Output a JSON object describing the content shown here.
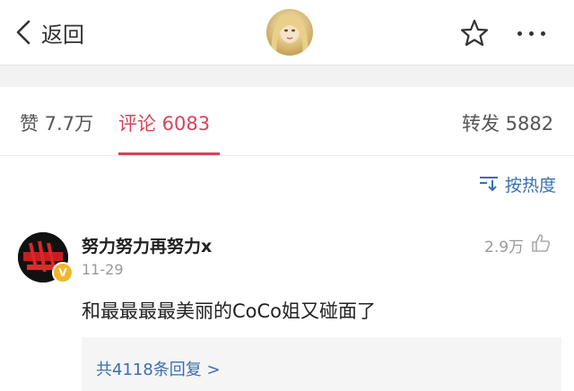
{
  "header": {
    "back_label": "返回",
    "avatar_icon": "profile-avatar",
    "star_icon": "star-icon",
    "more_icon": "more-icon"
  },
  "tabs": {
    "likes": "赞 7.7万",
    "comments": "评论 6083",
    "reposts": "转发 5882"
  },
  "sort": {
    "label": "按热度",
    "icon": "sort-icon"
  },
  "comment": {
    "author": "努力努力再努力x",
    "date": "11-29",
    "likes": "2.9万",
    "text": "和最最最最美丽的CoCo姐又碰面了",
    "replies_link": "共4118条回复 >"
  },
  "colors": {
    "accent": "#d9425a",
    "link": "#3b6fb0",
    "badge": "#f3b62b"
  }
}
